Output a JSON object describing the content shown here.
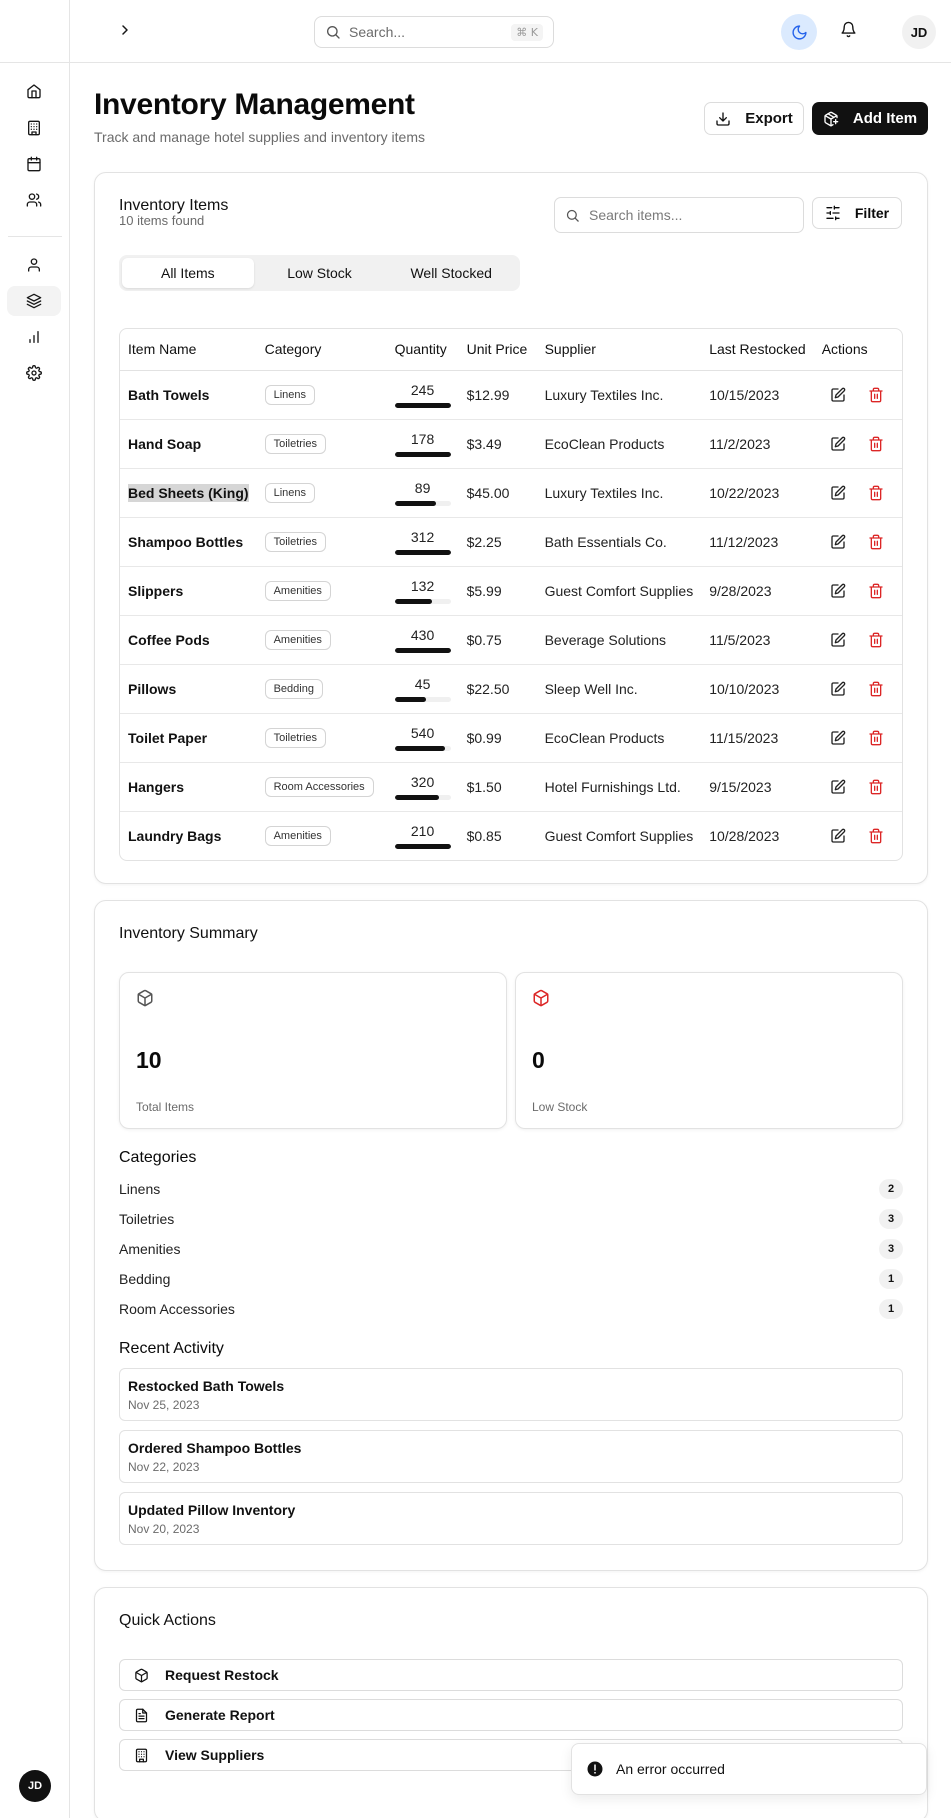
{
  "sidebar": {
    "nav": [
      "home-icon",
      "building-icon",
      "calendar-icon",
      "users-icon",
      "user-icon",
      "layers-icon",
      "bar-chart-icon",
      "settings-icon"
    ],
    "active": "layers-icon",
    "avatar_initials": "JD"
  },
  "topbar": {
    "search_placeholder": "Search...",
    "shortcut": "⌘ K",
    "avatar_initials": "JD"
  },
  "header": {
    "title": "Inventory Management",
    "subtitle": "Track and manage hotel supplies and inventory items",
    "export_label": "Export",
    "add_label": "Add Item"
  },
  "inventory": {
    "title": "Inventory Items",
    "count_text": "10 items found",
    "search_placeholder": "Search items...",
    "filter_label": "Filter",
    "tabs": [
      "All Items",
      "Low Stock",
      "Well Stocked"
    ],
    "active_tab": "All Items",
    "columns": [
      "Item Name",
      "Category",
      "Quantity",
      "Unit Price",
      "Supplier",
      "Last Restocked",
      "Actions"
    ],
    "rows": [
      {
        "name": "Bath Towels",
        "category": "Linens",
        "quantity": "245",
        "stock_level": 1.0,
        "price": "$12.99",
        "supplier": "Luxury Textiles Inc.",
        "restocked": "10/15/2023"
      },
      {
        "name": "Hand Soap",
        "category": "Toiletries",
        "quantity": "178",
        "stock_level": 1.0,
        "price": "$3.49",
        "supplier": "EcoClean Products",
        "restocked": "11/2/2023"
      },
      {
        "name": "Bed Sheets (King)",
        "category": "Linens",
        "quantity": "89",
        "stock_level": 0.74,
        "price": "$45.00",
        "supplier": "Luxury Textiles Inc.",
        "restocked": "10/22/2023"
      },
      {
        "name": "Shampoo Bottles",
        "category": "Toiletries",
        "quantity": "312",
        "stock_level": 1.0,
        "price": "$2.25",
        "supplier": "Bath Essentials Co.",
        "restocked": "11/12/2023"
      },
      {
        "name": "Slippers",
        "category": "Amenities",
        "quantity": "132",
        "stock_level": 0.66,
        "price": "$5.99",
        "supplier": "Guest Comfort Supplies",
        "restocked": "9/28/2023"
      },
      {
        "name": "Coffee Pods",
        "category": "Amenities",
        "quantity": "430",
        "stock_level": 1.0,
        "price": "$0.75",
        "supplier": "Beverage Solutions",
        "restocked": "11/5/2023"
      },
      {
        "name": "Pillows",
        "category": "Bedding",
        "quantity": "45",
        "stock_level": 0.56,
        "price": "$22.50",
        "supplier": "Sleep Well Inc.",
        "restocked": "10/10/2023"
      },
      {
        "name": "Toilet Paper",
        "category": "Toiletries",
        "quantity": "540",
        "stock_level": 0.9,
        "price": "$0.99",
        "supplier": "EcoClean Products",
        "restocked": "11/15/2023"
      },
      {
        "name": "Hangers",
        "category": "Room Accessories",
        "quantity": "320",
        "stock_level": 0.8,
        "price": "$1.50",
        "supplier": "Hotel Furnishings Ltd.",
        "restocked": "9/15/2023"
      },
      {
        "name": "Laundry Bags",
        "category": "Amenities",
        "quantity": "210",
        "stock_level": 1.0,
        "price": "$0.85",
        "supplier": "Guest Comfort Supplies",
        "restocked": "10/28/2023"
      }
    ],
    "highlighted_row": "Bed Sheets (King)"
  },
  "summary": {
    "title": "Inventory Summary",
    "total_value": "10",
    "total_label": "Total Items",
    "low_value": "0",
    "low_label": "Low Stock",
    "categories_title": "Categories",
    "categories": [
      {
        "name": "Linens",
        "count": "2"
      },
      {
        "name": "Toiletries",
        "count": "3"
      },
      {
        "name": "Amenities",
        "count": "3"
      },
      {
        "name": "Bedding",
        "count": "1"
      },
      {
        "name": "Room Accessories",
        "count": "1"
      }
    ],
    "activity_title": "Recent Activity",
    "activity": [
      {
        "title": "Restocked Bath Towels",
        "date": "Nov 25, 2023"
      },
      {
        "title": "Ordered Shampoo Bottles",
        "date": "Nov 22, 2023"
      },
      {
        "title": "Updated Pillow Inventory",
        "date": "Nov 20, 2023"
      }
    ]
  },
  "quick_actions": {
    "title": "Quick Actions",
    "items": [
      {
        "label": "Request Restock",
        "icon": "package-icon"
      },
      {
        "label": "Generate Report",
        "icon": "file-text-icon"
      },
      {
        "label": "View Suppliers",
        "icon": "building-icon"
      }
    ]
  },
  "toast": {
    "message": "An error occurred"
  },
  "colors": {
    "accent": "#111111",
    "danger": "#dc2626",
    "theme_toggle_bg": "#dbeafe"
  }
}
